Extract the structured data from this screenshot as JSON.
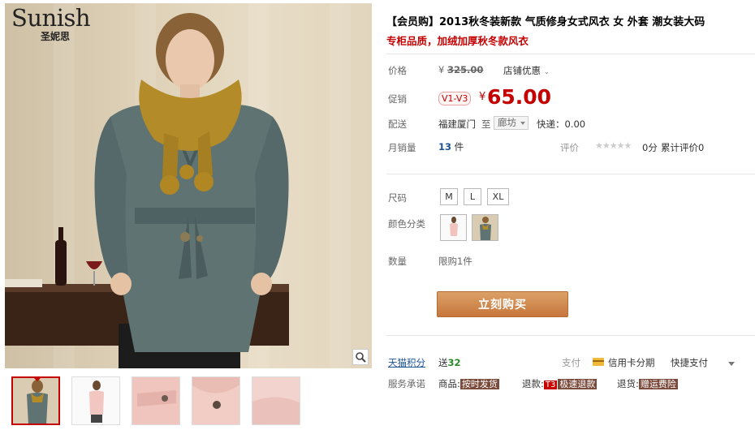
{
  "brand": {
    "name": "Sunish",
    "name_cn": "圣妮思"
  },
  "gallery": {
    "zoom_icon": "magnifier-icon",
    "thumbnails": [
      {
        "alt": "模特正面 灰绿风衣",
        "active": true
      },
      {
        "alt": "粉色风衣 全身"
      },
      {
        "alt": "粉色风衣 口袋细节"
      },
      {
        "alt": "粉色风衣 纽扣细节"
      },
      {
        "alt": "粉色风衣 面料细节"
      }
    ]
  },
  "product": {
    "title": "【会员购】2013秋冬装新款 气质修身女式风衣 女 外套 潮女装大码",
    "subtitle": "专柜品质，加绒加厚秋冬款风衣"
  },
  "price": {
    "label": "价格",
    "currency": "¥",
    "original": "325.00",
    "shop_promo": "店铺优惠"
  },
  "promo": {
    "label": "促销",
    "vip_tag": "V1-V3",
    "currency": "¥",
    "price": "65.00"
  },
  "shipping": {
    "label": "配送",
    "from": "福建厦门",
    "to_prefix": "至",
    "to": "廊坊",
    "express": "快递：0.00"
  },
  "sales": {
    "label": "月销量",
    "count": "13",
    "unit": "件",
    "rating_label": "评价",
    "stars": "★★★★★",
    "score": "0分",
    "review_count": "累计评价0"
  },
  "size": {
    "label": "尺码",
    "options": [
      "M",
      "L",
      "XL"
    ]
  },
  "color": {
    "label": "颜色分类",
    "options": [
      {
        "alt": "粉色"
      },
      {
        "alt": "灰绿色"
      }
    ]
  },
  "quantity": {
    "label": "数量",
    "limit": "限购1件"
  },
  "buy": {
    "label": "立刻购买"
  },
  "points": {
    "label": "天猫积分",
    "prefix": "送",
    "value": "32"
  },
  "payment": {
    "label": "支付",
    "card": "信用卡分期",
    "quick": "快捷支付"
  },
  "services": {
    "label": "服务承诺",
    "goods_prefix": "商品:",
    "goods_tag": "按时发货",
    "refund_prefix": "退款:",
    "refund_t3": "T3",
    "refund_tag": "极速退款",
    "return_prefix": "退货:",
    "return_tag": "赠运费险"
  }
}
